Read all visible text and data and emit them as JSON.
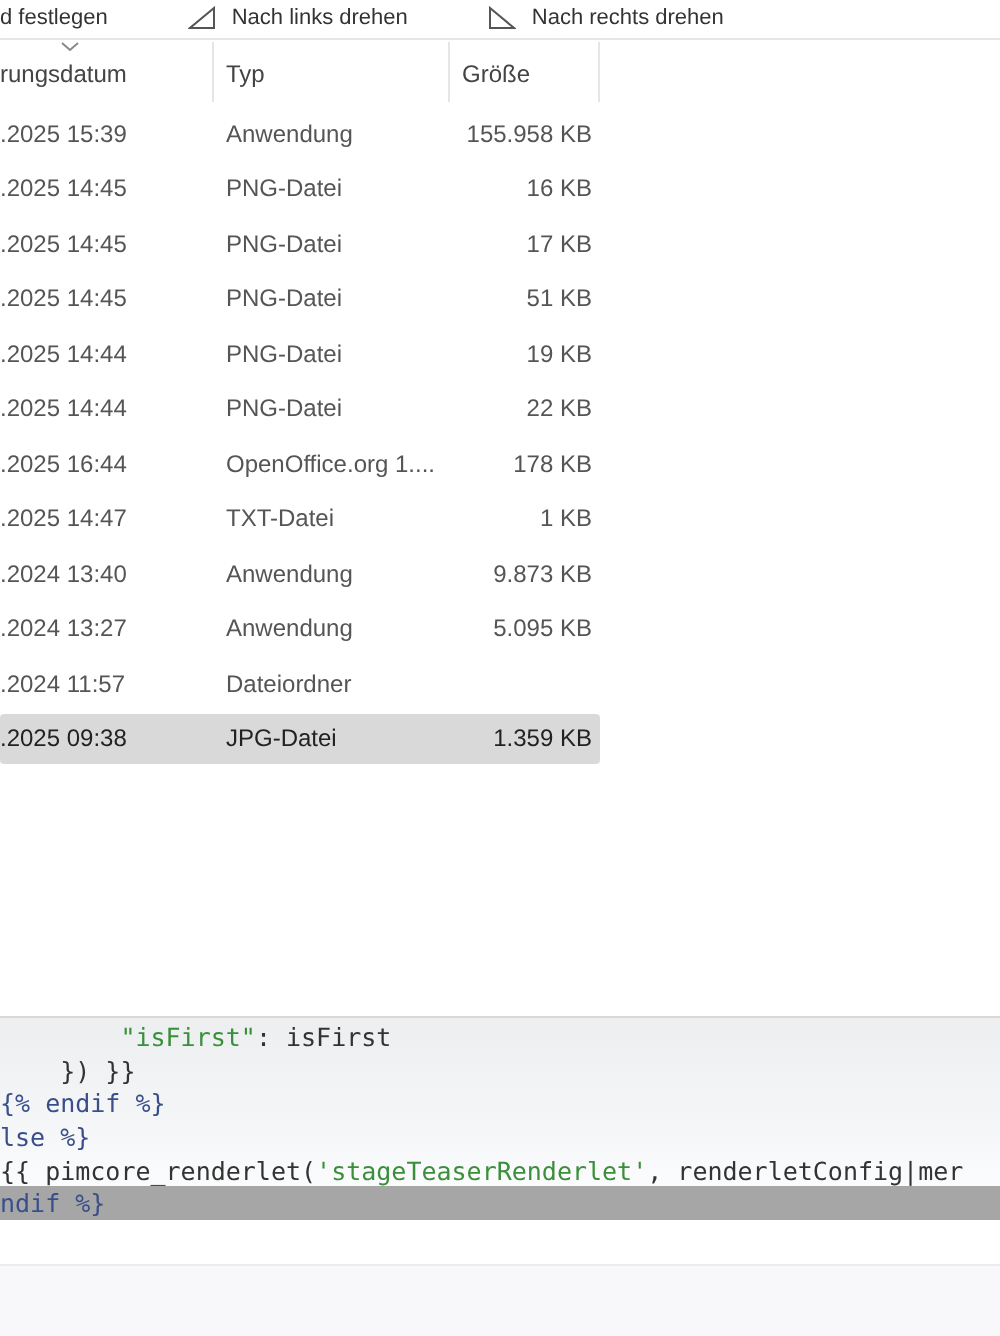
{
  "toolbar": {
    "items": [
      {
        "kind": "text",
        "label": "d festlegen"
      },
      {
        "kind": "rotate_left",
        "label": "Nach links drehen"
      },
      {
        "kind": "rotate_right",
        "label": "Nach rechts drehen"
      }
    ]
  },
  "table": {
    "columns": [
      {
        "label": "rungsdatum",
        "sorted": true
      },
      {
        "label": "Typ",
        "sorted": false
      },
      {
        "label": "Größe",
        "sorted": false
      }
    ],
    "rows": [
      {
        "date": ".2025 15:39",
        "type": "Anwendung",
        "size": "155.958 KB",
        "selected": false
      },
      {
        "date": ".2025 14:45",
        "type": "PNG-Datei",
        "size": "16 KB",
        "selected": false
      },
      {
        "date": ".2025 14:45",
        "type": "PNG-Datei",
        "size": "17 KB",
        "selected": false
      },
      {
        "date": ".2025 14:45",
        "type": "PNG-Datei",
        "size": "51 KB",
        "selected": false
      },
      {
        "date": ".2025 14:44",
        "type": "PNG-Datei",
        "size": "19 KB",
        "selected": false
      },
      {
        "date": ".2025 14:44",
        "type": "PNG-Datei",
        "size": "22 KB",
        "selected": false
      },
      {
        "date": ".2025 16:44",
        "type": "OpenOffice.org 1....",
        "size": "178 KB",
        "selected": false
      },
      {
        "date": ".2025 14:47",
        "type": "TXT-Datei",
        "size": "1 KB",
        "selected": false
      },
      {
        "date": ".2024 13:40",
        "type": "Anwendung",
        "size": "9.873 KB",
        "selected": false
      },
      {
        "date": ".2024 13:27",
        "type": "Anwendung",
        "size": "5.095 KB",
        "selected": false
      },
      {
        "date": ".2024 11:57",
        "type": "Dateiordner",
        "selected": false
      },
      {
        "date": ".2025 09:38",
        "type": "JPG-Datei",
        "size": "1.359 KB",
        "selected": true
      }
    ]
  },
  "code": {
    "lines": [
      {
        "highlighted": false,
        "segments": [
          {
            "kind": "string",
            "text": "        \"isFirst\""
          },
          {
            "kind": "plain",
            "text": ": isFirst"
          }
        ]
      },
      {
        "highlighted": false,
        "segments": [
          {
            "kind": "plain",
            "text": "    }) }}"
          }
        ]
      },
      {
        "highlighted": false,
        "segments": [
          {
            "kind": "tag",
            "text": "{% endif %}"
          }
        ]
      },
      {
        "highlighted": false,
        "segments": [
          {
            "kind": "tag",
            "text": "lse %}"
          }
        ]
      },
      {
        "highlighted": false,
        "segments": [
          {
            "kind": "plain",
            "text": "{{ pimcore_renderlet("
          },
          {
            "kind": "string",
            "text": "'stageTeaserRenderlet'"
          },
          {
            "kind": "plain",
            "text": ", renderletConfig|mer"
          }
        ]
      },
      {
        "highlighted": true,
        "segments": [
          {
            "kind": "tag",
            "text": "ndif %}"
          }
        ]
      }
    ]
  }
}
